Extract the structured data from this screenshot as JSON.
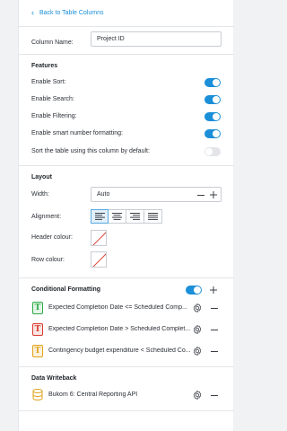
{
  "back_link": "Back to Table Columns",
  "column_name": {
    "label": "Column Name:",
    "value": "Project ID"
  },
  "features": {
    "title": "Features",
    "items": [
      {
        "label": "Enable Sort:",
        "on": true
      },
      {
        "label": "Enable Search:",
        "on": true
      },
      {
        "label": "Enable Filtering:",
        "on": true
      },
      {
        "label": "Enable smart number formatting:",
        "on": true
      },
      {
        "label": "Sort the table using this column by default:",
        "on": false
      }
    ]
  },
  "layout": {
    "title": "Layout",
    "width_label": "Width:",
    "width_value": "Auto",
    "alignment_label": "Alignment:",
    "alignment_selected": "left",
    "header_colour_label": "Header colour:",
    "row_colour_label": "Row colour:"
  },
  "conditional_formatting": {
    "title": "Conditional Formatting",
    "enabled": true,
    "rules": [
      {
        "icon_color": "#2eaa46",
        "icon_bg": "#e4f5e7",
        "text": "Expected Completion Date  <=  Scheduled Comp..."
      },
      {
        "icon_color": "#d83a2f",
        "icon_bg": "#fbe6e4",
        "text": "Expected Completion Date  >  Scheduled Complet..."
      },
      {
        "icon_color": "#e0a21b",
        "icon_bg": "#fcf1dc",
        "text": "Contingency budget expenditure  <  Scheduled Co..."
      }
    ]
  },
  "data_writeback": {
    "title": "Data Writeback",
    "item": "Bukom 6: Central Reporting API",
    "icon_color": "#e0a21b"
  },
  "colors": {
    "accent": "#1b8fd8"
  }
}
